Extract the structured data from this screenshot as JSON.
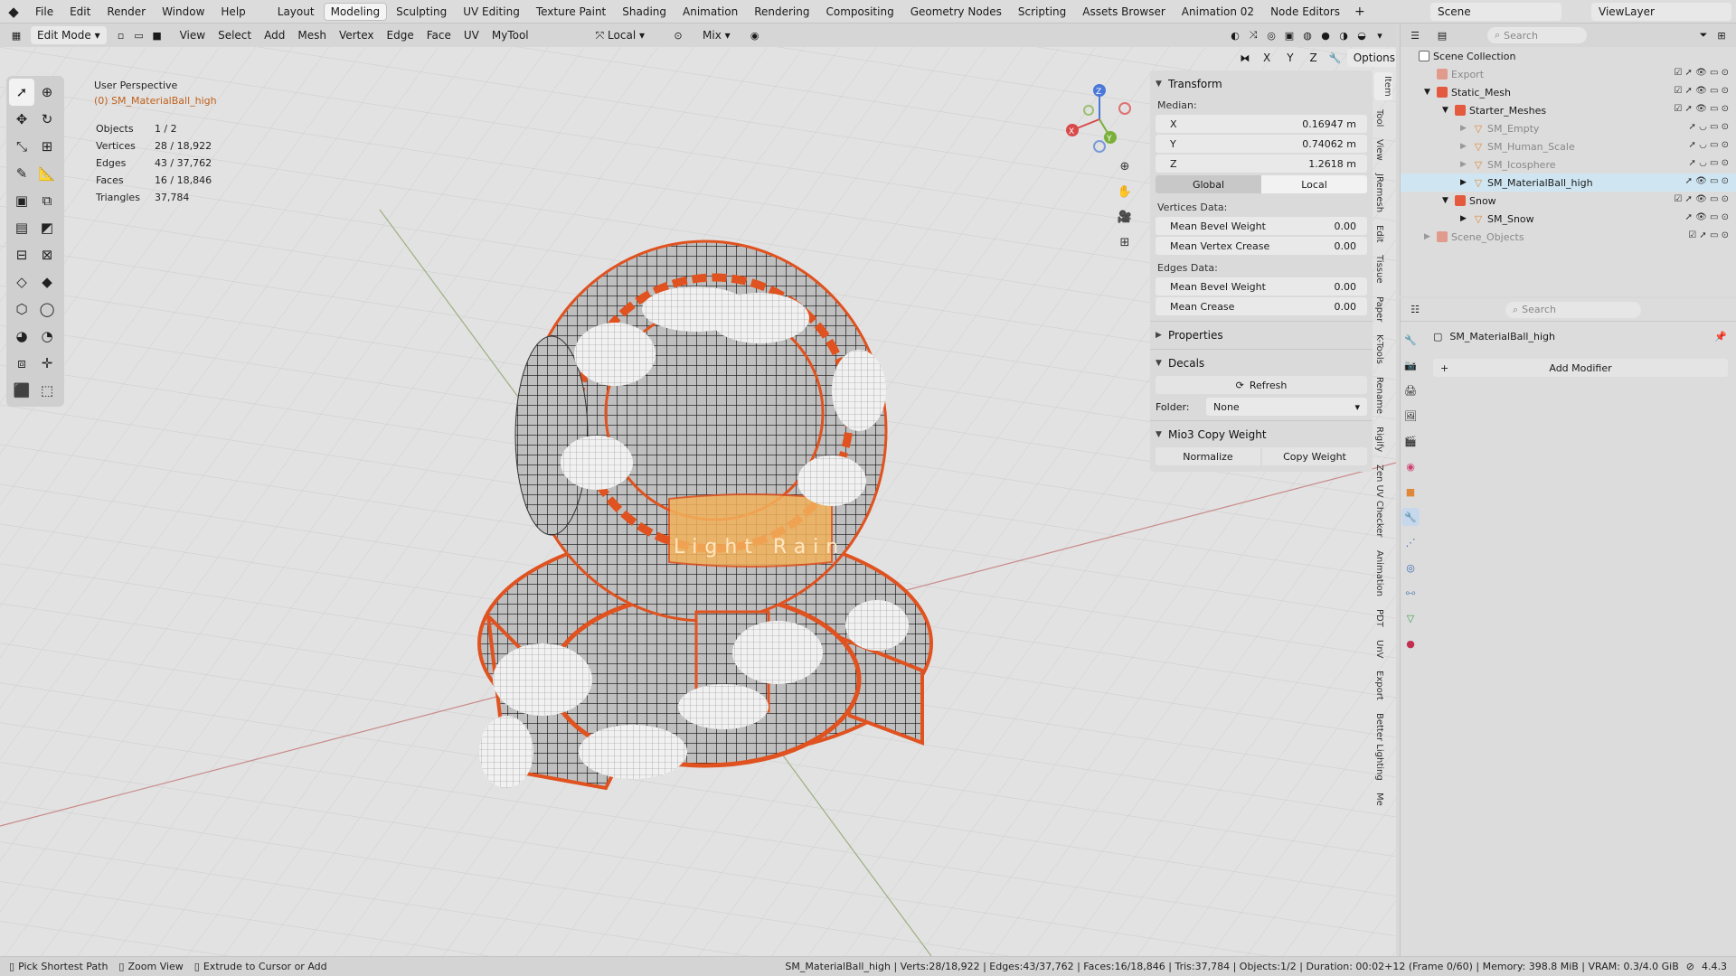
{
  "topbar": {
    "logo": "◆",
    "menus": [
      "File",
      "Edit",
      "Render",
      "Window",
      "Help"
    ],
    "workspaces": [
      "Layout",
      "Modeling",
      "Sculpting",
      "UV Editing",
      "Texture Paint",
      "Shading",
      "Animation",
      "Rendering",
      "Compositing",
      "Geometry Nodes",
      "Scripting",
      "Assets Browser",
      "Animation 02",
      "Node Editors"
    ],
    "active_workspace": "Modeling",
    "add": "+",
    "scene": "Scene",
    "view_layer": "ViewLayer"
  },
  "header": {
    "mode": "Edit Mode",
    "menus": [
      "View",
      "Select",
      "Add",
      "Mesh",
      "Vertex",
      "Edge",
      "Face",
      "UV",
      "MyTool"
    ],
    "orientation": "Local",
    "pivot": "Mix",
    "options": "Options",
    "axes": [
      "X",
      "Y",
      "Z"
    ]
  },
  "viewport": {
    "perspective": "User Perspective",
    "object": "(0) SM_MaterialBall_high",
    "stats": [
      {
        "k": "Objects",
        "v": "1 / 2"
      },
      {
        "k": "Vertices",
        "v": "28 / 18,922"
      },
      {
        "k": "Edges",
        "v": "43 / 37,762"
      },
      {
        "k": "Faces",
        "v": "16 / 18,846"
      },
      {
        "k": "Triangles",
        "v": "37,784"
      }
    ],
    "gizmo": {
      "x": "X",
      "y": "Y",
      "z": "Z"
    },
    "mesh_text": "Light Rain"
  },
  "npanel": {
    "transform": "Transform",
    "median": "Median:",
    "xyz": [
      {
        "k": "X",
        "v": "0.16947 m"
      },
      {
        "k": "Y",
        "v": "0.74062 m"
      },
      {
        "k": "Z",
        "v": "1.2618 m"
      }
    ],
    "global": "Global",
    "local": "Local",
    "vdata": "Vertices Data:",
    "vfields": [
      {
        "k": "Mean Bevel Weight",
        "v": "0.00"
      },
      {
        "k": "Mean Vertex Crease",
        "v": "0.00"
      }
    ],
    "edata": "Edges Data:",
    "efields": [
      {
        "k": "Mean Bevel Weight",
        "v": "0.00"
      },
      {
        "k": "Mean Crease",
        "v": "0.00"
      }
    ],
    "properties": "Properties",
    "decals": "Decals",
    "refresh": "Refresh",
    "folder": "Folder:",
    "folder_val": "None",
    "copyweight": "Mio3 Copy Weight",
    "normalize": "Normalize",
    "copy": "Copy Weight"
  },
  "vtabs": [
    "Item",
    "Tool",
    "View",
    "JRemesh",
    "Edit",
    "Tissue",
    "Paper",
    "K-Tools",
    "Rename",
    "Rigify",
    "Zen UV Checker",
    "Animation",
    "PDT",
    "UnV",
    "Export",
    "Better Lighting",
    "Me"
  ],
  "outliner": {
    "search": "Search",
    "rows": [
      {
        "name": "Scene Collection",
        "indent": 0,
        "type": "scene"
      },
      {
        "name": "Export",
        "indent": 1,
        "type": "col",
        "dim": true
      },
      {
        "name": "Static_Mesh",
        "indent": 1,
        "type": "col"
      },
      {
        "name": "Starter_Meshes",
        "indent": 2,
        "type": "col"
      },
      {
        "name": "SM_Empty",
        "indent": 3,
        "type": "mesh",
        "dim": true
      },
      {
        "name": "SM_Human_Scale",
        "indent": 3,
        "type": "mesh",
        "dim": true
      },
      {
        "name": "SM_Icosphere",
        "indent": 3,
        "type": "mesh",
        "dim": true
      },
      {
        "name": "SM_MaterialBall_high",
        "indent": 3,
        "type": "mesh",
        "sel": true
      },
      {
        "name": "Snow",
        "indent": 2,
        "type": "col"
      },
      {
        "name": "SM_Snow",
        "indent": 3,
        "type": "mesh"
      },
      {
        "name": "Scene_Objects",
        "indent": 1,
        "type": "col",
        "dim": true
      }
    ]
  },
  "properties": {
    "search": "Search",
    "object": "SM_MaterialBall_high",
    "add_modifier": "Add Modifier"
  },
  "status": {
    "pick": "Pick Shortest Path",
    "zoom": "Zoom View",
    "extrude": "Extrude to Cursor or Add",
    "info": "SM_MaterialBall_high | Verts:28/18,922 | Edges:43/37,762 | Faces:16/18,846 | Tris:37,784 | Objects:1/2 | Duration: 00:02+12 (Frame 0/60) | Memory: 398.8 MiB | VRAM: 0.3/4.0 GiB",
    "version": "4.4.3"
  }
}
